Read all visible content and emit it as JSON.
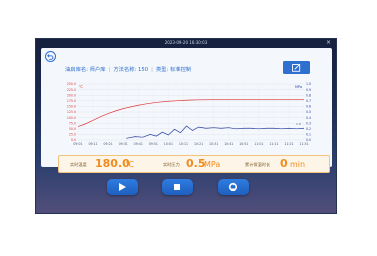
{
  "header": {
    "clock": "2023-09-20 16:30:03"
  },
  "info": {
    "well_name": "油启库名: 师户库",
    "plan_name": "方法名称: 150",
    "type": "类型: 标准控制"
  },
  "chart_data": {
    "type": "line",
    "ylabel_left": "℃",
    "ylabel_right": "MPa",
    "y_left_ticks": [
      "250.0",
      "225.0",
      "200.0",
      "175.0",
      "150.0",
      "125.0",
      "100.0",
      "75.0",
      "50.0",
      "25.0",
      "0.0"
    ],
    "y_right_ticks": [
      "1.0",
      "0.9",
      "0.8",
      "0.7",
      "0.6",
      "0.5",
      "0.4",
      "0.3",
      "0.2",
      "0.1",
      "0.0"
    ],
    "x_ticks": [
      "09:01",
      "09:11",
      "09:21",
      "09:31",
      "09:41",
      "09:51",
      "10:01",
      "10:11",
      "10:21",
      "10:31",
      "10:41",
      "10:51",
      "11:01",
      "11:11",
      "11:21",
      "11:31"
    ],
    "ylim_left": [
      0,
      250
    ],
    "ylim_right": [
      0,
      1
    ],
    "grid": true,
    "series": [
      {
        "axis": "left",
        "color": "#e0393b",
        "x": [
          0,
          0.5,
          1,
          1.5,
          2,
          2.5,
          3,
          3.5,
          4,
          4.5,
          5,
          5.5,
          6,
          6.5,
          7,
          7.5,
          8,
          9,
          10,
          11,
          12,
          13,
          14,
          15
        ],
        "values": [
          60,
          72,
          88,
          104,
          118,
          130,
          140,
          148,
          155,
          161,
          166,
          170,
          173,
          175,
          177,
          178.5,
          179.5,
          180,
          180,
          180,
          180,
          180,
          180,
          180
        ]
      },
      {
        "axis": "right",
        "color": "#2a3f9e",
        "x": [
          3.2,
          3.8,
          4.3,
          4.8,
          5.2,
          5.6,
          6.0,
          6.4,
          6.8,
          7.2,
          7.6,
          8.0,
          8.5,
          9,
          9.5,
          10,
          10.5,
          11,
          11.5,
          12,
          12.5,
          13,
          13.5,
          14,
          14.5,
          15
        ],
        "values": [
          0.03,
          0.06,
          0.05,
          0.1,
          0.07,
          0.14,
          0.09,
          0.19,
          0.13,
          0.25,
          0.17,
          0.23,
          0.21,
          0.22,
          0.21,
          0.22,
          0.2,
          0.21,
          0.21,
          0.2,
          0.21,
          0.21,
          0.2,
          0.21,
          0.2,
          0.21
        ]
      }
    ],
    "annotation": "1.0"
  },
  "status": {
    "temp_label": "实时温度",
    "temp_value": "180.0",
    "temp_unit": "℃",
    "pressure_label": "实时压力",
    "pressure_value": "0.5",
    "pressure_unit": "MPa",
    "time_label": "累计保温时长",
    "time_value": "0",
    "time_unit": "min"
  },
  "controls": {
    "icons": [
      "play-icon",
      "stop-icon",
      "recycle-icon"
    ]
  }
}
